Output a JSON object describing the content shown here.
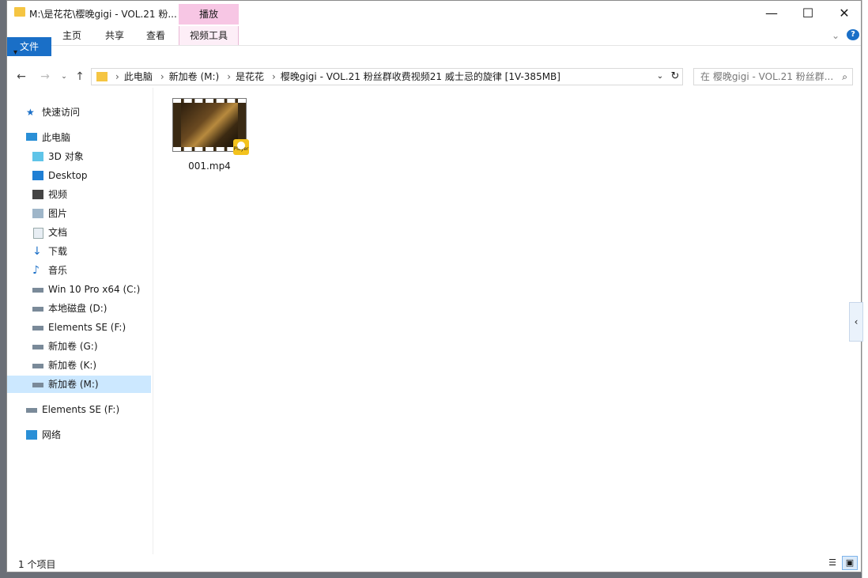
{
  "window": {
    "title": "M:\\是花花\\樱晚gigi - VOL.21 粉...",
    "minimize": "—",
    "maximize": "☐",
    "close": "✕"
  },
  "ribbon": {
    "context_group": "播放",
    "tabs": [
      "文件",
      "主页",
      "共享",
      "查看",
      "视频工具"
    ],
    "collapse": "⌄",
    "help": "?"
  },
  "qat": "▾",
  "address": {
    "crumbs": [
      "此电脑",
      "新加卷 (M:)",
      "是花花",
      "樱晚gigi - VOL.21 粉丝群收费视频21 威士忌的旋律 [1V-385MB]"
    ],
    "search_placeholder": "在 樱晚gigi - VOL.21 粉丝群..."
  },
  "nav": {
    "quick_access": "快速访问",
    "this_pc": "此电脑",
    "items": [
      "3D 对象",
      "Desktop",
      "视频",
      "图片",
      "文档",
      "下载",
      "音乐",
      "Win 10 Pro x64 (C:)",
      "本地磁盘 (D:)",
      "Elements SE (F:)",
      "新加卷 (G:)",
      "新加卷 (K:)",
      "新加卷 (M:)"
    ],
    "external": "Elements SE (F:)",
    "network": "网络"
  },
  "files": [
    {
      "name": "001.mp4",
      "badge": "Player"
    }
  ],
  "status": {
    "count": "1 个项目"
  },
  "colors": {
    "accent": "#1a6fc7",
    "context_tab": "#f7c6e4",
    "selected": "#cce8ff"
  }
}
